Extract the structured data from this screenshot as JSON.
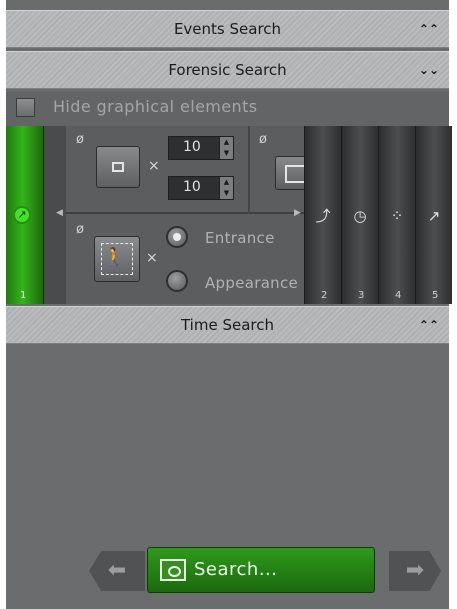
{
  "headers": {
    "events": {
      "title": "Events Search",
      "chevron": "⌃⌃"
    },
    "forensic": {
      "title": "Forensic Search",
      "chevron": "⌄⌄"
    },
    "time": {
      "title": "Time Search",
      "chevron": "⌃⌃"
    }
  },
  "hide_graphics": {
    "label": "Hide graphical elements",
    "checked": false
  },
  "filter_slots": {
    "active": {
      "number": "1",
      "icon": "move-circle-icon"
    },
    "others": [
      {
        "number": "2",
        "icon": "line-crossing-icon"
      },
      {
        "number": "3",
        "icon": "clock-icon"
      },
      {
        "number": "4",
        "icon": "dots-icon"
      },
      {
        "number": "5",
        "icon": "move-circle-icon"
      }
    ]
  },
  "object_size": {
    "width": "10",
    "height": "10"
  },
  "motion_type": {
    "options": [
      {
        "label": "Entrance",
        "selected": true
      },
      {
        "label": "Appearance",
        "selected": false
      }
    ]
  },
  "search_button": {
    "label": "Search..."
  },
  "colors": {
    "accent_green": "#2e9a1b",
    "panel": "#6b6c6d",
    "header": "#b9bbbc"
  }
}
